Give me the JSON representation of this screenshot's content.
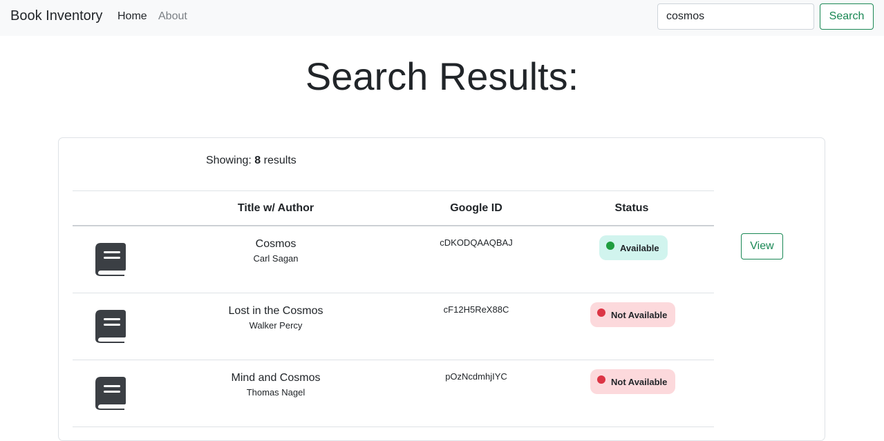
{
  "nav": {
    "brand": "Book Inventory",
    "home": "Home",
    "about": "About",
    "search_value": "cosmos",
    "search_button": "Search"
  },
  "page": {
    "title": "Search Results:"
  },
  "results": {
    "showing_label": "Showing:",
    "count": "8",
    "count_suffix": "results",
    "headers": {
      "title": "Title w/ Author",
      "google_id": "Google ID",
      "status": "Status"
    },
    "view_label": "View",
    "rows": [
      {
        "title": "Cosmos",
        "author": "Carl Sagan",
        "google_id": "cDKODQAAQBAJ",
        "status": "Available"
      },
      {
        "title": "Lost in the Cosmos",
        "author": "Walker Percy",
        "google_id": "cF12H5ReX88C",
        "status": "Not Available"
      },
      {
        "title": "Mind and Cosmos",
        "author": "Thomas Nagel",
        "google_id": "pOzNcdmhjIYC",
        "status": "Not Available"
      }
    ]
  },
  "colors": {
    "accent_green": "#198754",
    "available_bg": "#d1f4ee",
    "unavailable_bg": "#fcd9dc",
    "available_dot": "#1f9d3f",
    "unavailable_dot": "#dc3545"
  },
  "icons": {
    "book": "book-icon",
    "status_dot": "status-dot-icon"
  }
}
